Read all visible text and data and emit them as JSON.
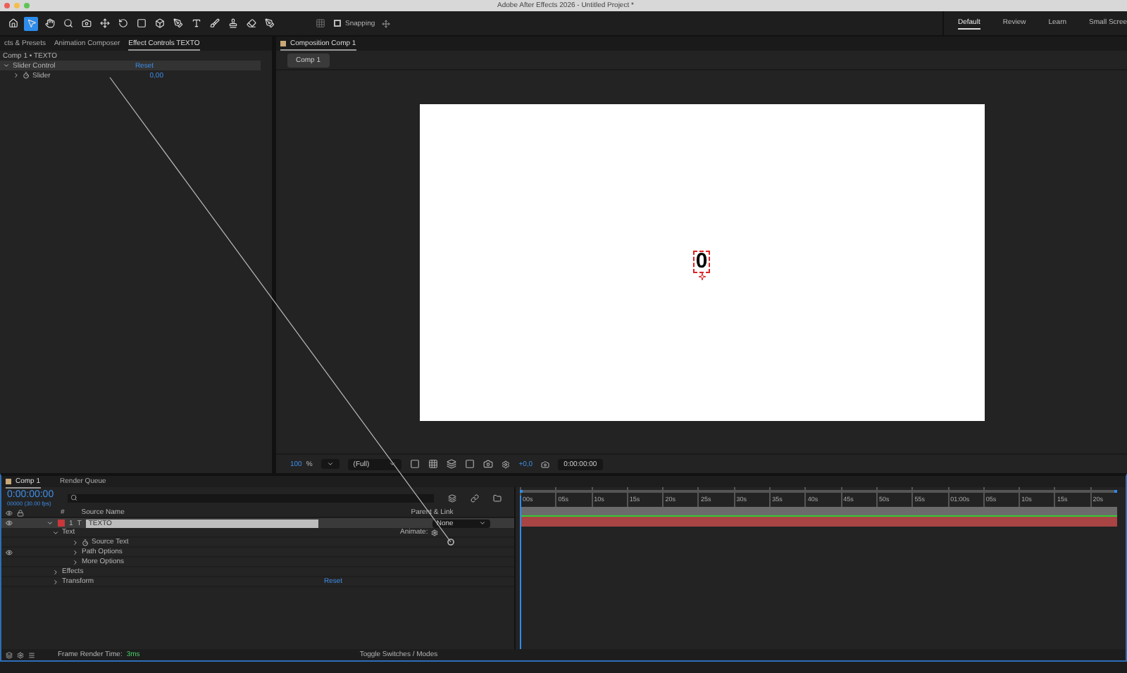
{
  "window": {
    "title": "Adobe After Effects 2026 - Untitled Project *"
  },
  "toolbar": {
    "snapping": {
      "label": "Snapping",
      "checked": false
    },
    "workspaces": [
      {
        "label": "Default",
        "selected": true
      },
      {
        "label": "Review",
        "selected": false
      },
      {
        "label": "Learn",
        "selected": false
      },
      {
        "label": "Small Scree",
        "selected": false
      }
    ]
  },
  "left_panel": {
    "tabs": [
      {
        "label": "cts & Presets",
        "selected": false
      },
      {
        "label": "Animation Composer",
        "selected": false
      },
      {
        "label": "Effect Controls TEXTO",
        "selected": true
      }
    ],
    "breadcrumb": "Comp 1 • TEXTO",
    "effects": [
      {
        "name": "Slider Control",
        "expanded": true,
        "action": "Reset",
        "properties": [
          {
            "name": "Slider",
            "value": "0,00",
            "expanded": false
          }
        ]
      }
    ]
  },
  "viewer": {
    "tab": "Composition Comp 1",
    "breadcrumb": "Comp 1",
    "canvas_text": "0",
    "zoom": "100",
    "zoom_unit": "%",
    "resolution": "(Full)",
    "exposure": "+0,0",
    "timecode": "0:00:00:00"
  },
  "timeline": {
    "tabs": [
      {
        "label": "Comp 1",
        "selected": true
      },
      {
        "label": "Render Queue",
        "selected": false
      }
    ],
    "timecode": "0:00:00:00",
    "fps": "00000 (30.00 fps)",
    "columns": {
      "number": "#",
      "source_name": "Source Name",
      "parent": "Parent & Link"
    },
    "layer": {
      "index": "1",
      "type_glyph": "T",
      "name": "TEXTO",
      "parent": "None",
      "selected": true,
      "color": "#c8383a"
    },
    "animate": "Animate:",
    "properties": [
      {
        "name": "Text",
        "expanded": true,
        "stopwatch": false,
        "eye": false,
        "children": [
          {
            "name": "Source Text",
            "expanded": false,
            "stopwatch": true,
            "eye": false
          },
          {
            "name": "Path Options",
            "expanded": false,
            "stopwatch": false,
            "eye": true
          },
          {
            "name": "More Options",
            "expanded": false,
            "stopwatch": false,
            "eye": false
          }
        ]
      },
      {
        "name": "Effects",
        "expanded": false,
        "stopwatch": false,
        "eye": false
      },
      {
        "name": "Transform",
        "expanded": false,
        "stopwatch": false,
        "eye": false,
        "action": "Reset"
      }
    ],
    "ruler": [
      "00s",
      "05s",
      "10s",
      "15s",
      "20s",
      "25s",
      "30s",
      "35s",
      "40s",
      "45s",
      "50s",
      "55s",
      "01:00s",
      "05s",
      "10s",
      "15s",
      "20s"
    ],
    "status": {
      "label": "Frame Render Time:",
      "value": "3ms",
      "toggle": "Toggle Switches / Modes"
    }
  }
}
